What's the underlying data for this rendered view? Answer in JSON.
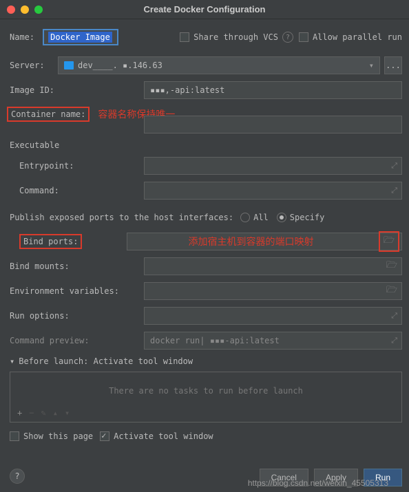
{
  "window": {
    "title": "Create Docker Configuration"
  },
  "fields": {
    "name_label": "Name:",
    "name_value": "Docker Image",
    "share_label": "Share through VCS",
    "allow_parallel_label": "Allow parallel run",
    "server_label": "Server:",
    "server_value": "dev____. ▪.146.63",
    "image_id_label": "Image ID:",
    "image_id_value": "▪▪▪,-api:latest",
    "container_name_label": "Container name:",
    "container_name_value": "",
    "executable_header": "Executable",
    "entrypoint_label": "Entrypoint:",
    "entrypoint_value": "",
    "command_label": "Command:",
    "command_value": "",
    "publish_label": "Publish exposed ports to the host interfaces:",
    "radio_all": "All",
    "radio_specify": "Specify",
    "bind_ports_label": "Bind ports:",
    "bind_ports_value": "",
    "bind_mounts_label": "Bind mounts:",
    "bind_mounts_value": "",
    "env_vars_label": "Environment variables:",
    "env_vars_value": "",
    "run_options_label": "Run options:",
    "run_options_value": "",
    "command_preview_label": "Command preview:",
    "command_preview_value": "docker run| ▪▪▪-api:latest"
  },
  "annotations": {
    "container_unique": "容器名称保持唯一",
    "port_mapping": "添加宿主机到容器的端口映射"
  },
  "before_launch": {
    "header": "Before launch: Activate tool window",
    "empty": "There are no tasks to run before launch",
    "show_page": "Show this page",
    "activate": "Activate tool window"
  },
  "buttons": {
    "cancel": "Cancel",
    "apply": "Apply",
    "run": "Run"
  },
  "watermark": "https://blog.csdn.net/weixin_45505313"
}
